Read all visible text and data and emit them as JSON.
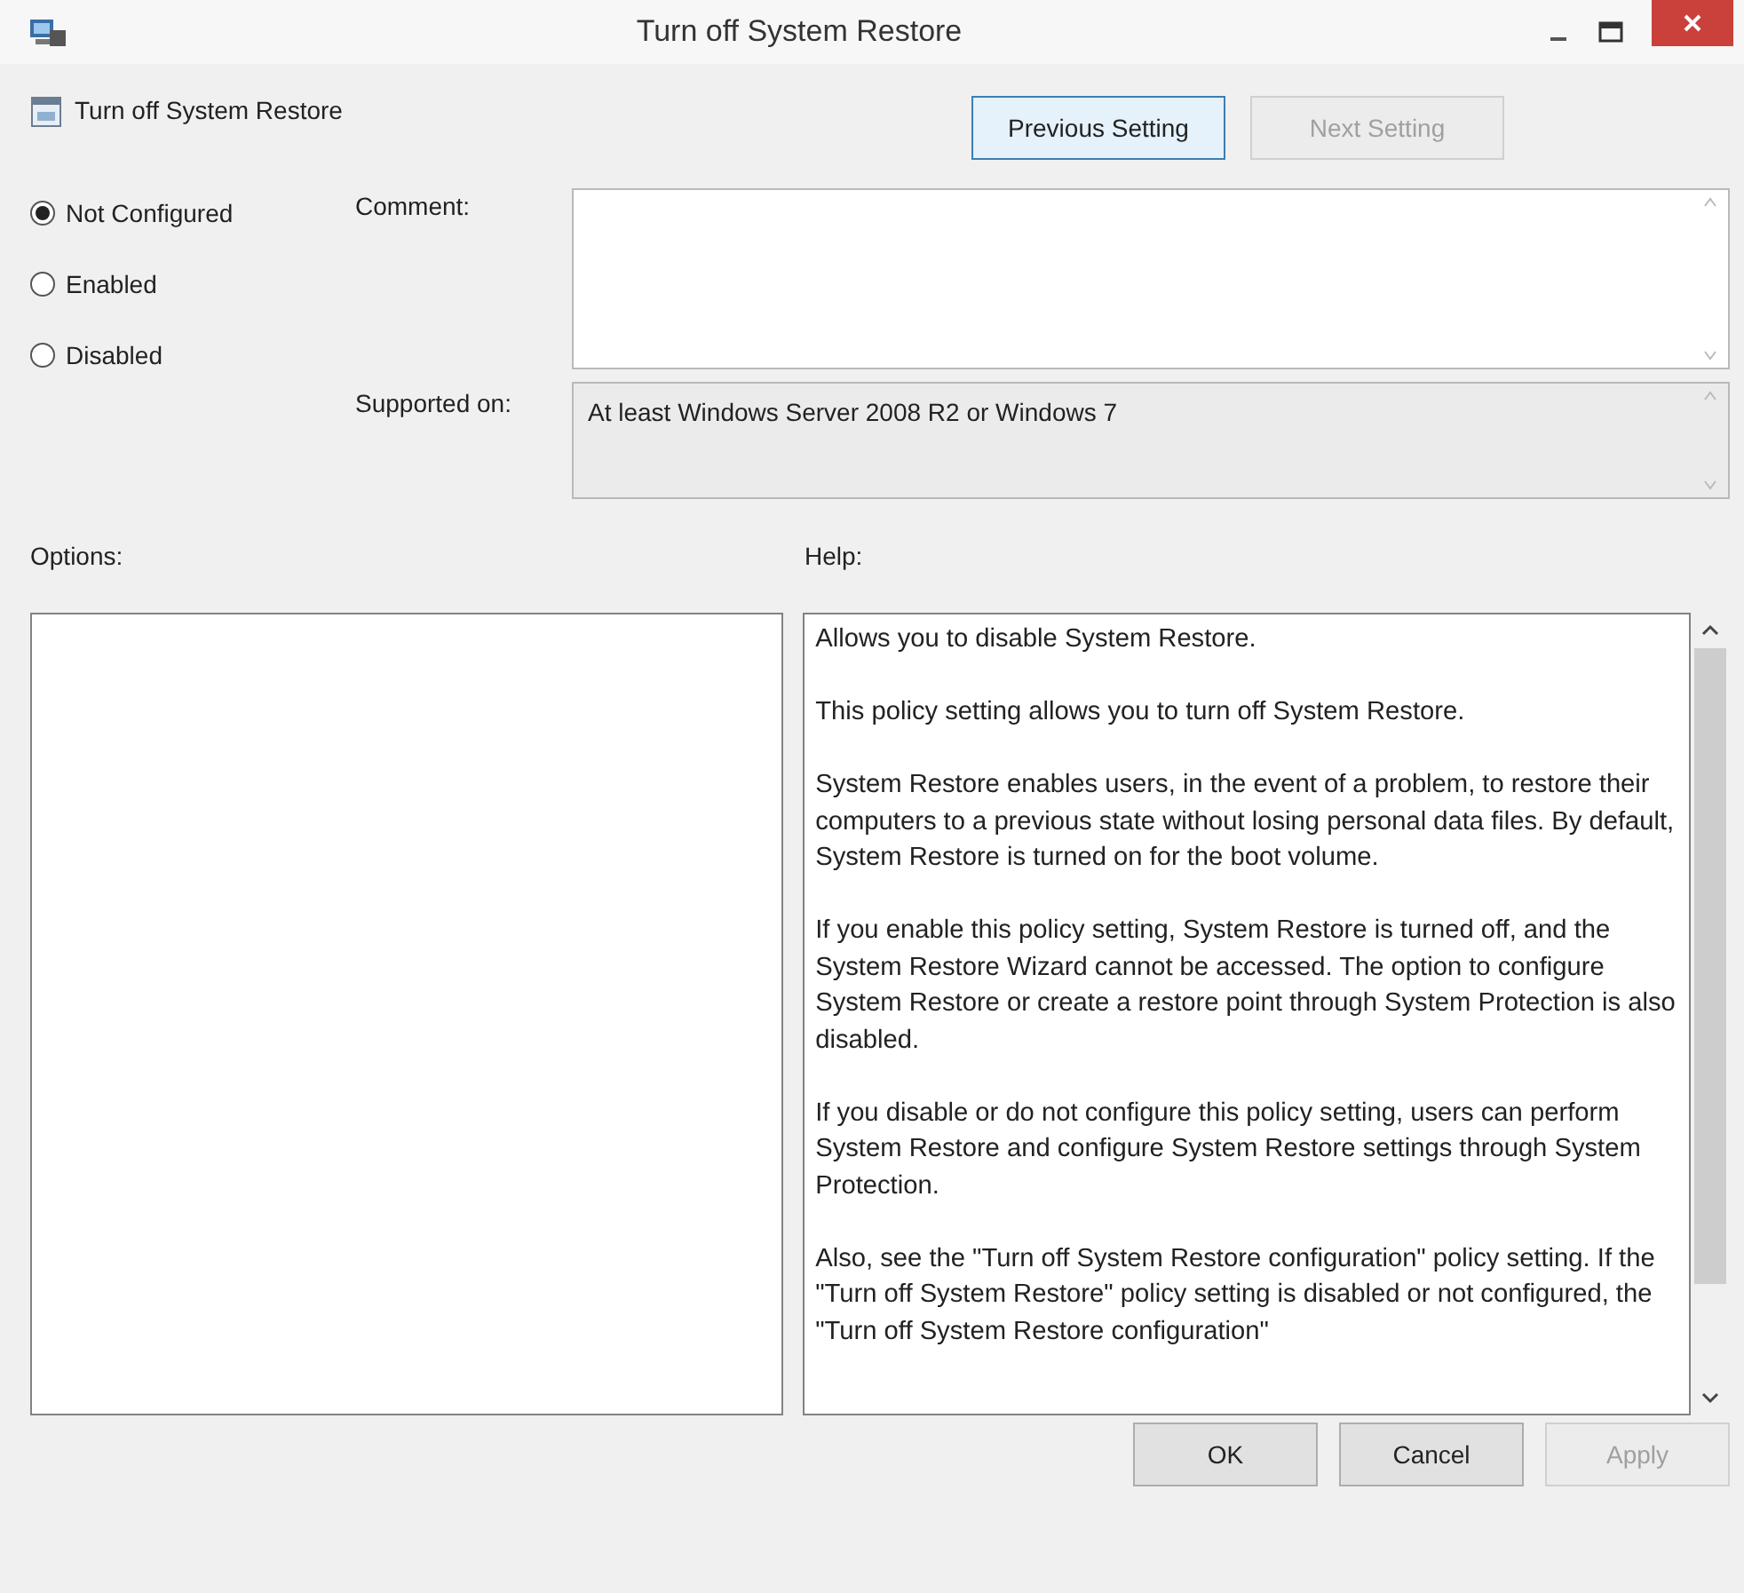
{
  "window": {
    "title": "Turn off System Restore"
  },
  "policy": {
    "name": "Turn off System Restore"
  },
  "nav_buttons": [
    {
      "label": "Previous Setting",
      "disabled": false
    },
    {
      "label": "Next Setting",
      "disabled": true
    }
  ],
  "state_options": [
    {
      "label": "Not Configured",
      "selected": true
    },
    {
      "label": "Enabled",
      "selected": false
    },
    {
      "label": "Disabled",
      "selected": false
    }
  ],
  "comment": {
    "label": "Comment:"
  },
  "supported_on": {
    "label": "Supported on:",
    "value": "At least Windows Server 2008 R2 or Windows 7"
  },
  "options": {
    "label": "Options:"
  },
  "help": {
    "label": "Help:",
    "paragraphs": [
      "Allows you to disable System Restore.",
      "This policy setting allows you to turn off System Restore.",
      "System Restore enables users, in the event of a problem, to restore their computers to a previous state without losing personal data files. By default, System Restore is turned on for the boot volume.",
      "If you enable this policy setting, System Restore is turned off, and the System Restore Wizard cannot be accessed. The option to configure System Restore or create a restore point through System Protection is also disabled.",
      "If you disable or do not configure this policy setting, users can perform System Restore and configure System Restore settings through System Protection.",
      "Also, see the \"Turn off System Restore configuration\" policy setting. If the \"Turn off System Restore\" policy setting is disabled or not configured, the \"Turn off System Restore configuration\""
    ]
  },
  "buttons": [
    {
      "label": "OK",
      "disabled": false
    },
    {
      "label": "Cancel",
      "disabled": false
    },
    {
      "label": "Apply",
      "disabled": true
    }
  ]
}
